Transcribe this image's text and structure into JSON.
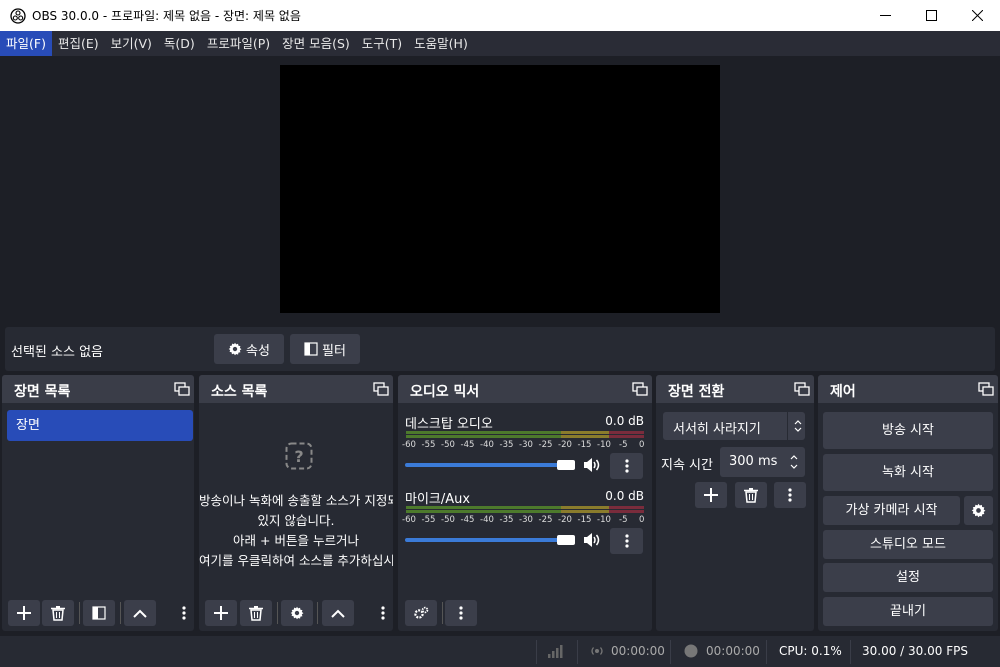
{
  "title": "OBS 30.0.0 - 프로파일: 제목 없음 - 장면: 제목 없음",
  "menu": [
    {
      "label": "파일(F)",
      "active": true
    },
    {
      "label": "편집(E)"
    },
    {
      "label": "보기(V)"
    },
    {
      "label": "독(D)"
    },
    {
      "label": "프로파일(P)"
    },
    {
      "label": "장면 모음(S)"
    },
    {
      "label": "도구(T)"
    },
    {
      "label": "도움말(H)"
    }
  ],
  "context": {
    "no_source": "선택된 소스 없음",
    "properties": "속성",
    "filters": "필터"
  },
  "scenes": {
    "title": "장면 목록",
    "items": [
      "장면"
    ]
  },
  "sources": {
    "title": "소스 목록",
    "empty_lines": [
      "방송이나 녹화에 송출할 소스가 지정되어",
      "있지 않습니다.",
      "아래 + 버튼을 누르거나",
      "여기를 우클릭하여 소스를 추가하십시오."
    ]
  },
  "mixer": {
    "title": "오디오 믹서",
    "ticks": [
      "-60",
      "-55",
      "-50",
      "-45",
      "-40",
      "-35",
      "-30",
      "-25",
      "-20",
      "-15",
      "-10",
      "-5",
      "0"
    ],
    "channels": [
      {
        "name": "데스크탑 오디오",
        "db": "0.0 dB",
        "volume": 1.0
      },
      {
        "name": "마이크/Aux",
        "db": "0.0 dB",
        "volume": 1.0
      }
    ]
  },
  "transitions": {
    "title": "장면 전환",
    "selected": "서서히 사라지기",
    "duration_label": "지속 시간",
    "duration": "300 ms"
  },
  "controls": {
    "title": "제어",
    "stream": "방송 시작",
    "record": "녹화 시작",
    "virtualcam": "가상 카메라 시작",
    "studio": "스튜디오 모드",
    "settings": "설정",
    "exit": "끝내기"
  },
  "status": {
    "stream_time": "00:00:00",
    "rec_time": "00:00:00",
    "cpu": "CPU: 0.1%",
    "fps": "30.00 / 30.00 FPS"
  },
  "colors": {
    "accent": "#284cb8",
    "panel": "#272a33",
    "background": "#1d1f26",
    "button": "#3b3e4a"
  }
}
